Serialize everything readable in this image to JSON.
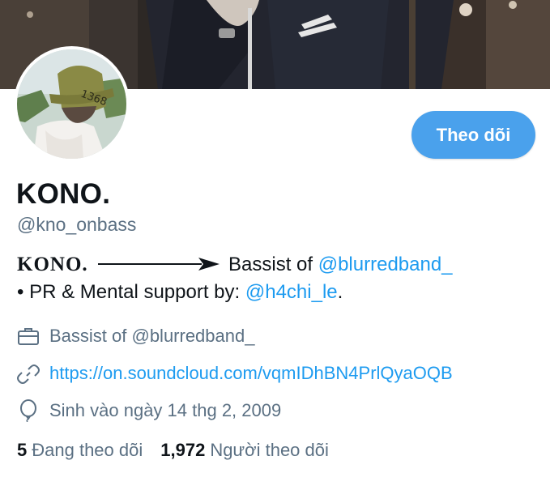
{
  "profile": {
    "display_name": "KONO.",
    "handle": "@kno_onbass",
    "follow_label": "Theo dõi",
    "bio": {
      "name_styled": "KONO.",
      "line1_text": "Bassist of",
      "line1_mention": "@blurredband_",
      "line2_prefix": "• PR & Mental support by:",
      "line2_mention": "@h4chi_le",
      "line2_suffix": "."
    },
    "work": "Bassist of @blurredband_",
    "url": "https://on.soundcloud.com/vqmIDhBN4PrlQyaOQB",
    "birthday": "Sinh vào ngày 14 thg 2, 2009",
    "following_count": "5",
    "following_label": "Đang theo dõi",
    "followers_count": "1,972",
    "followers_label": "Người theo dõi"
  },
  "avatar_cap_text": "1368",
  "icons": {
    "work": "briefcase-icon",
    "url": "link-icon",
    "birthday": "balloon-icon"
  },
  "colors": {
    "accent": "#1d9bf0",
    "button": "#4aa1ec",
    "secondary_text": "#5b7083",
    "primary_text": "#0f1419"
  }
}
